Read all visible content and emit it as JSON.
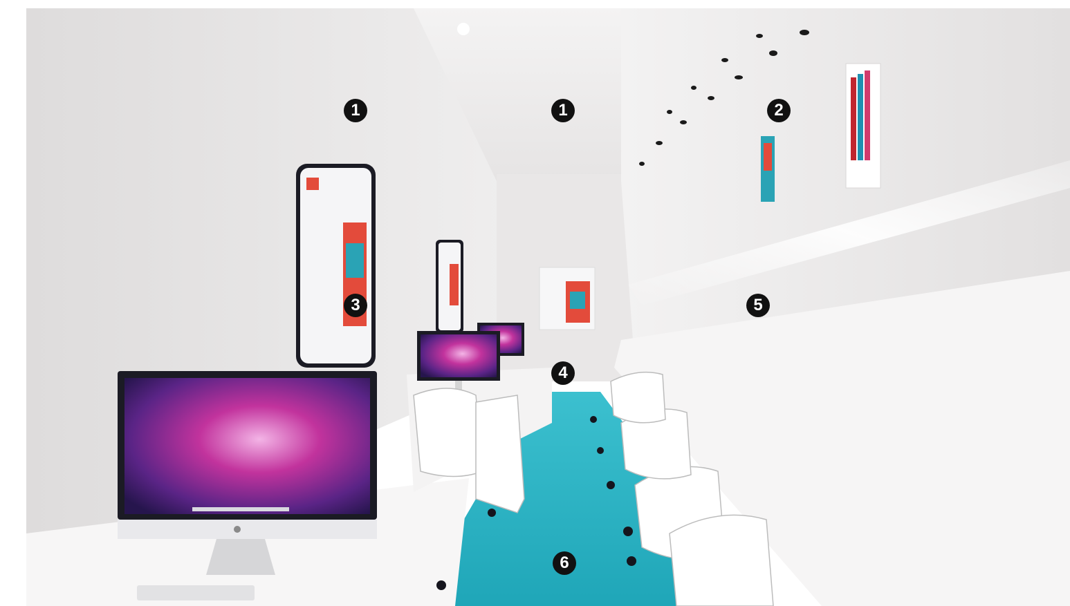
{
  "image": {
    "subject": "computer-lab",
    "palette": {
      "wall": "#eceaea",
      "ceiling": "#f2f1f1",
      "floor": "#2bb3c4",
      "monitor_frame": "#1b1b24",
      "screen_magenta": "#c2339d",
      "screen_purple": "#3a1d6e",
      "poster_red": "#e34b3b",
      "marker_bg": "#111111",
      "marker_fg": "#ffffff"
    }
  },
  "markers": [
    {
      "id": "m1a",
      "label": "1"
    },
    {
      "id": "m1b",
      "label": "1"
    },
    {
      "id": "m2",
      "label": "2"
    },
    {
      "id": "m3",
      "label": "3"
    },
    {
      "id": "m4",
      "label": "4"
    },
    {
      "id": "m5",
      "label": "5"
    },
    {
      "id": "m6",
      "label": "6"
    }
  ]
}
